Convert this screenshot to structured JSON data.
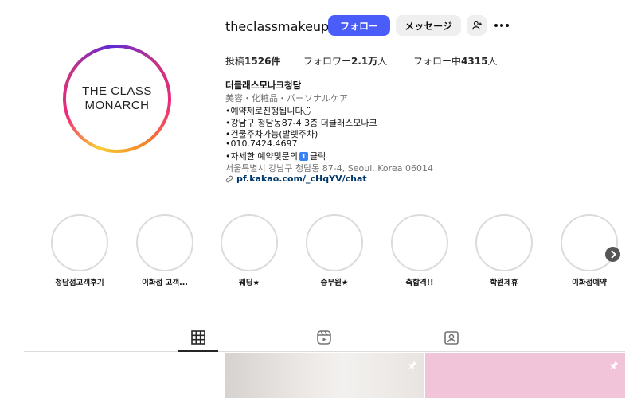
{
  "profile": {
    "username": "theclassmakeup",
    "logo_line1": "THE CLASS",
    "logo_line2": "MONARCH"
  },
  "actions": {
    "follow_label": "フォロー",
    "message_label": "メッセージ",
    "add_user_icon": "person-add-icon",
    "more_icon": "more-horizontal-icon"
  },
  "stats": {
    "posts_label": "投稿",
    "posts_value": "1526件",
    "followers_label": "フォロワー",
    "followers_value": "2.1万",
    "followers_suffix": "人",
    "following_label": "フォロー中",
    "following_value": "4315",
    "following_suffix": "人"
  },
  "bio": {
    "name": "더클래스모나크청담",
    "category": "美容・化粧品・パーソナルケア",
    "lines": [
      "•예약제로진행됩니다◡̈",
      "•강남구 청담동87-4 3층 더클래스모나크",
      "•건물주차가능(발렛주차)",
      "•010.7424.4697",
      "•자세한 예약및문의",
      "클릭"
    ],
    "address": "서울특별시 강남구 청담동 87-4, Seoul, Korea 06014",
    "link": "pf.kakao.com/_cHqYV/chat"
  },
  "highlights": [
    {
      "label": "청담점고객후기"
    },
    {
      "label": "이화점 고객..."
    },
    {
      "label": "웨딩★"
    },
    {
      "label": "승무원★"
    },
    {
      "label": "축합격!!"
    },
    {
      "label": "학원제휴"
    },
    {
      "label": "이화점예약"
    }
  ],
  "tabs": {
    "posts_icon": "grid-icon",
    "reels_icon": "reels-icon",
    "tagged_icon": "tagged-icon"
  },
  "colors": {
    "follow_button": "#4a5df9",
    "link": "#00376b",
    "post3_bg": "#f2c4da"
  }
}
